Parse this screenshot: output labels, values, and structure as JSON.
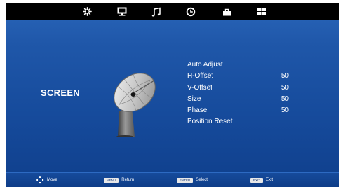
{
  "tabs": [
    {
      "name": "picture-tab-icon"
    },
    {
      "name": "screen-tab-icon"
    },
    {
      "name": "sound-tab-icon"
    },
    {
      "name": "time-tab-icon"
    },
    {
      "name": "lock-tab-icon"
    },
    {
      "name": "setup-tab-icon"
    }
  ],
  "page": {
    "title": "SCREEN",
    "icon": "satellite-dish-icon"
  },
  "menu": {
    "auto_adjust": "Auto Adjust",
    "h_offset": {
      "label": "H-Offset",
      "value": "50"
    },
    "v_offset": {
      "label": "V-Offset",
      "value": "50"
    },
    "size": {
      "label": "Size",
      "value": "50"
    },
    "phase": {
      "label": "Phase",
      "value": "50"
    },
    "position_reset": "Position Reset"
  },
  "hints": {
    "move": "Move",
    "menu_key": "MENU",
    "return": "Return",
    "enter_key": "ENTER",
    "select": "Select",
    "exit_key": "EXIT",
    "exit": "Exit"
  },
  "colors": {
    "background": "#1f57a9",
    "topbar": "#000000",
    "text": "#ffffff"
  }
}
